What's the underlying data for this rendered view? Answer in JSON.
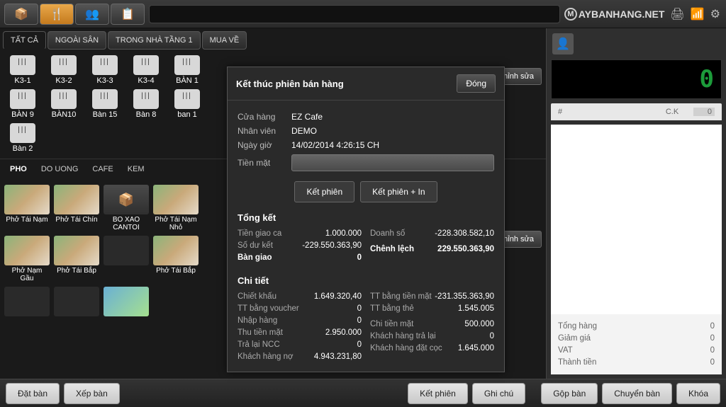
{
  "brand": "AYBANHANG.NET",
  "topbar_tabs": [
    "TẤT CẢ",
    "NGOÀI SÂN",
    "TRONG NHÀ TẦNG 1",
    "MUA VỀ"
  ],
  "tables": [
    "K3-1",
    "K3-2",
    "K3-3",
    "K3-4",
    "BÀN 1",
    "BÀN 9",
    "BÀN10",
    "Bàn 15",
    "Bàn 8",
    "ban 1",
    "Bàn 2"
  ],
  "categories": [
    "PHO",
    "DO UONG",
    "CAFE",
    "KEM"
  ],
  "products": [
    {
      "name": "Phở Tái Nạm",
      "img": "pho"
    },
    {
      "name": "Phở Tái Chín",
      "img": "pho"
    },
    {
      "name": "BO XAO CANTOI",
      "img": "box"
    },
    {
      "name": "Phở Tái Nạm Nhỏ",
      "img": "pho"
    },
    {
      "name": "Phở Nạm Gầu",
      "img": "pho"
    },
    {
      "name": "Phở Tái Bắp",
      "img": "pho"
    },
    {
      "name": "",
      "img": "empty"
    },
    {
      "name": "Phở Tái Bắp",
      "img": "pho"
    },
    {
      "name": "",
      "img": "empty"
    },
    {
      "name": "",
      "img": "empty"
    },
    {
      "name": "",
      "img": "drink"
    }
  ],
  "side_btns": {
    "edit1": "hỉnh sửa",
    "edit2": "hỉnh sửa"
  },
  "modal": {
    "title": "Kết thúc phiên bán hàng",
    "close": "Đóng",
    "info": [
      {
        "lbl": "Cửa hàng",
        "val": "EZ Cafe"
      },
      {
        "lbl": "Nhân viên",
        "val": "DEMO"
      },
      {
        "lbl": "Ngày giờ",
        "val": "14/02/2014 4:26:15 CH"
      },
      {
        "lbl": "Tiền mặt",
        "val": ""
      }
    ],
    "btn1": "Kết phiên",
    "btn2": "Kết phiên + In",
    "summary_title": "Tổng kết",
    "summary_left": [
      {
        "k": "Tiền giao ca",
        "v": "1.000.000"
      },
      {
        "k": "Số dư kết",
        "v": "-229.550.363,90"
      },
      {
        "k": "Bàn giao",
        "v": "0",
        "bold": true
      }
    ],
    "summary_right": [
      {
        "k": "Doanh số",
        "v": "-228.308.582,10"
      },
      {
        "k": "",
        "v": ""
      },
      {
        "k": "Chênh lệch",
        "v": "229.550.363,90",
        "bold": true
      }
    ],
    "detail_title": "Chi tiết",
    "detail_left": [
      {
        "k": "Chiết khấu",
        "v": "1.649.320,40"
      },
      {
        "k": "TT bằng voucher",
        "v": "0"
      },
      {
        "k": "Nhập hàng",
        "v": "0"
      },
      {
        "k": "Thu tiền mặt",
        "v": "2.950.000"
      },
      {
        "k": "Trả lại NCC",
        "v": "0"
      },
      {
        "k": "Khách hàng nợ",
        "v": "4.943.231,80"
      }
    ],
    "detail_right": [
      {
        "k": "TT bằng tiền mặt",
        "v": "-231.355.363,90"
      },
      {
        "k": "TT bằng thẻ",
        "v": "1.545.005"
      },
      {
        "k": "",
        "v": ""
      },
      {
        "k": "Chi tiền mặt",
        "v": "500.000"
      },
      {
        "k": "Khách hàng trả lại",
        "v": "0"
      },
      {
        "k": "Khách hàng đặt cọc",
        "v": "1.645.000"
      }
    ]
  },
  "order": {
    "display": "0",
    "head_hash": "#",
    "head_ck": "C.K",
    "head_zero": "0",
    "totals": [
      {
        "k": "Tổng hàng",
        "v": "0"
      },
      {
        "k": "Giảm giá",
        "v": "0"
      },
      {
        "k": "VAT",
        "v": "0"
      },
      {
        "k": "Thành tiền",
        "v": "0"
      }
    ]
  },
  "footer": {
    "dat_ban": "Đặt bàn",
    "xep_ban": "Xếp bàn",
    "ket_phien": "Kết phiên",
    "ghi_chu": "Ghi chú",
    "gop_ban": "Gộp bàn",
    "chuyen_ban": "Chuyển bàn",
    "khoa": "Khóa"
  }
}
